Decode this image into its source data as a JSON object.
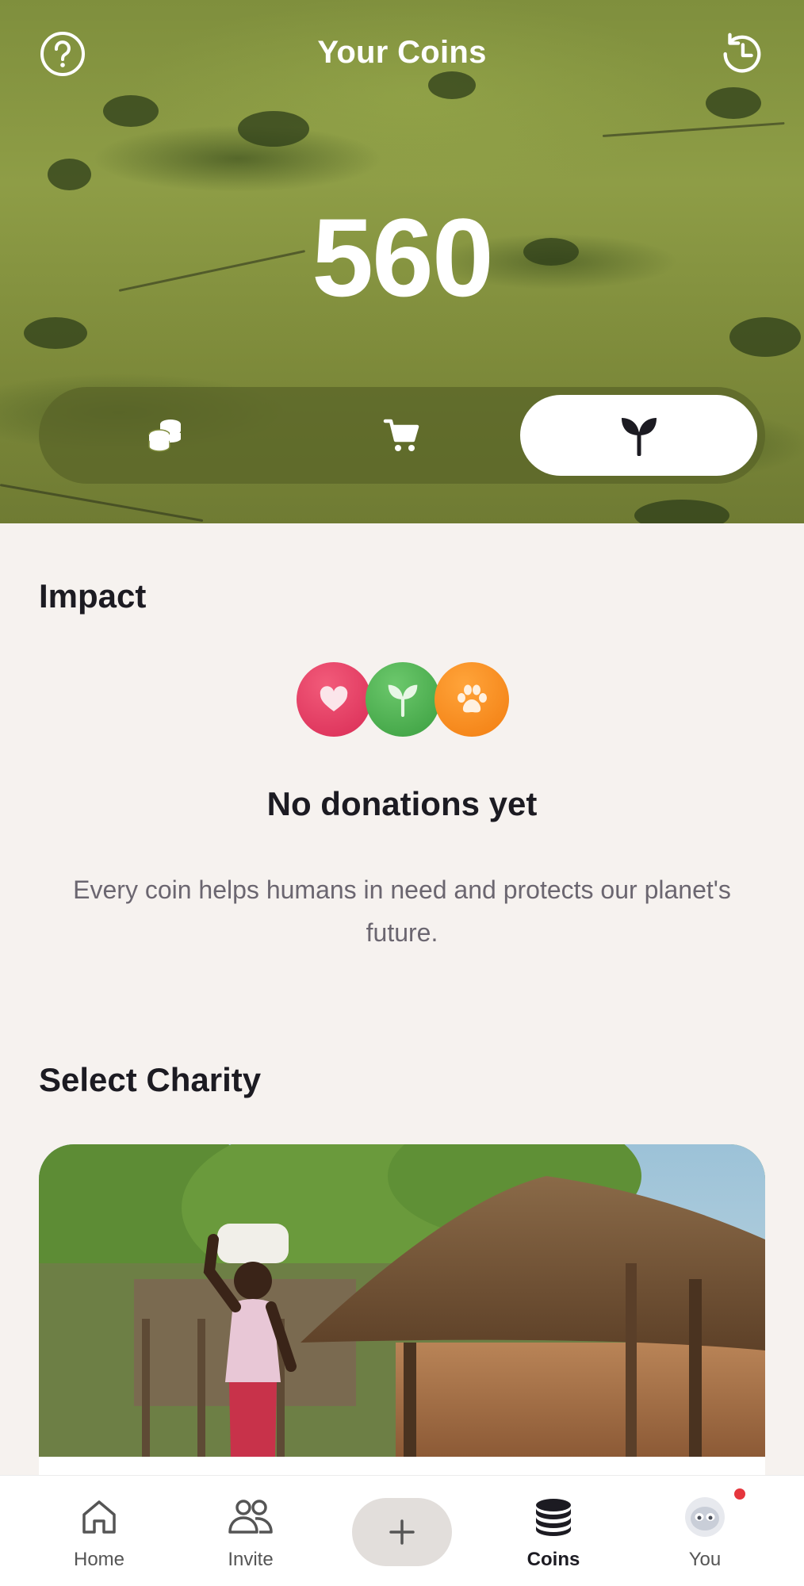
{
  "header": {
    "title": "Your Coins",
    "help_icon": "help-circle-icon",
    "history_icon": "history-clock-icon"
  },
  "coins": {
    "balance": "560"
  },
  "segmented_control": {
    "items": [
      {
        "icon": "coins-stack-icon",
        "active": false
      },
      {
        "icon": "shopping-cart-icon",
        "active": false
      },
      {
        "icon": "sprout-icon",
        "active": true
      }
    ]
  },
  "impact": {
    "title": "Impact",
    "icons": [
      {
        "icon": "heart-icon",
        "color": "#e33a64"
      },
      {
        "icon": "sprout-icon",
        "color": "#4cb24f"
      },
      {
        "icon": "paw-icon",
        "color": "#f7891c"
      }
    ],
    "empty_title": "No donations yet",
    "empty_description": "Every coin helps humans in need and protects our planet's future."
  },
  "charity": {
    "title": "Select Charity"
  },
  "bottom_nav": {
    "items": [
      {
        "label": "Home",
        "icon": "home-icon",
        "active": false
      },
      {
        "label": "Invite",
        "icon": "people-icon",
        "active": false
      },
      {
        "label": "",
        "icon": "plus-icon",
        "active": false
      },
      {
        "label": "Coins",
        "icon": "coins-stack-icon",
        "active": true
      },
      {
        "label": "You",
        "icon": "avatar-icon",
        "active": false
      }
    ]
  },
  "colors": {
    "background": "#f6f2ef",
    "text_primary": "#1c1b22",
    "text_secondary": "#6b6670",
    "notification": "#e5363d"
  }
}
